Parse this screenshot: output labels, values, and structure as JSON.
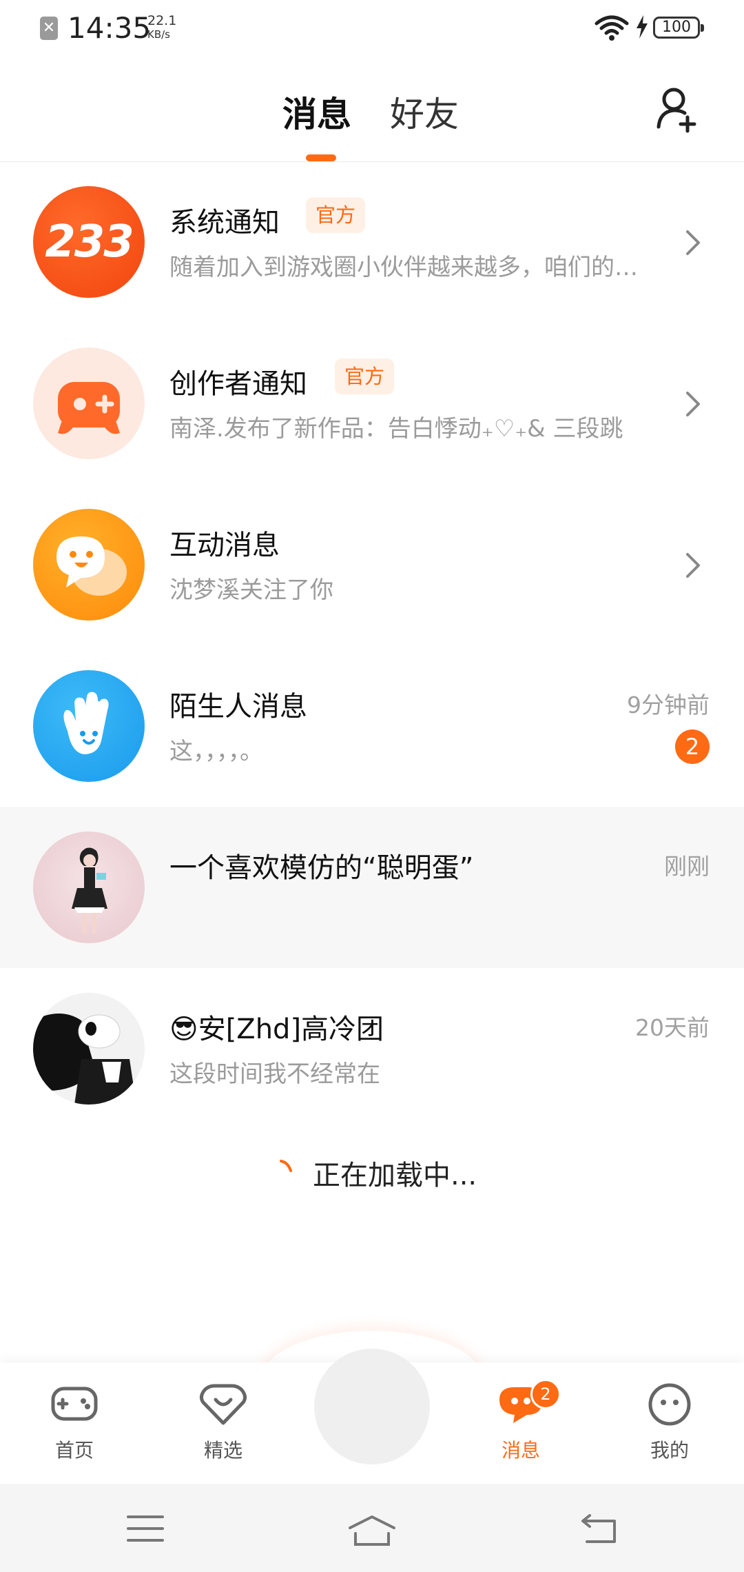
{
  "status_bar": {
    "time": "14:35",
    "speed_value": "22.1",
    "speed_unit": "KB/s",
    "battery": "100"
  },
  "header": {
    "tabs": [
      {
        "label": "消息"
      },
      {
        "label": "好友"
      }
    ],
    "active_tab": "消息"
  },
  "rows": [
    {
      "title": "系统通知",
      "badge": "官方",
      "subtitle": "随着加入到游戏圈小伙伴越来越多，咱们的…"
    },
    {
      "title": "创作者通知",
      "badge": "官方",
      "subtitle": "南泽.发布了新作品：告白悸动₊♡₊& 三段跳"
    },
    {
      "title": "互动消息",
      "subtitle": "沈梦溪关注了你"
    },
    {
      "title": "陌生人消息",
      "subtitle": "这，，，，。",
      "time": "9分钟前",
      "unread": "2"
    },
    {
      "title": "一个喜欢模仿的“聪明蛋”",
      "subtitle": "",
      "time": "刚刚"
    },
    {
      "title": "😎安[Zhd]高冷团",
      "subtitle": "这段时间我不经常在",
      "time": "20天前"
    }
  ],
  "avatar_233_text": "233",
  "loading_text": "正在加载中...",
  "bottom_nav": [
    {
      "label": "首页",
      "icon": "gamepad-icon"
    },
    {
      "label": "精选",
      "icon": "heart-diamond-icon"
    },
    {
      "label": "消息",
      "icon": "chat-face-icon",
      "badge": "2",
      "active": true
    },
    {
      "label": "我的",
      "icon": "face-icon"
    }
  ],
  "colors": {
    "accent": "#ff6a13",
    "badge_bg": "#fff0e6",
    "blue": "#29a8f2"
  }
}
